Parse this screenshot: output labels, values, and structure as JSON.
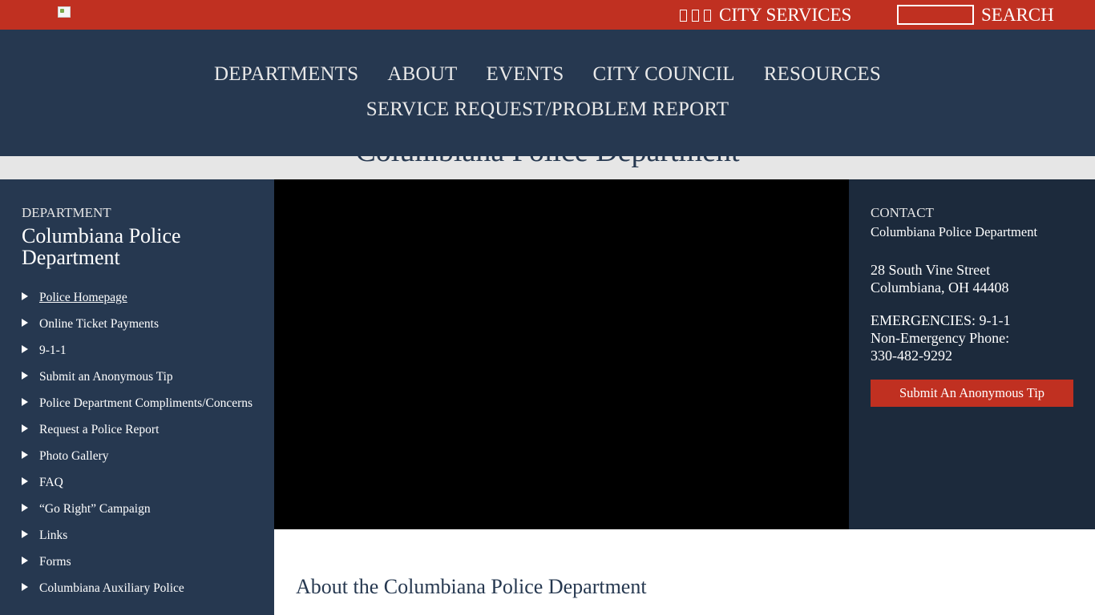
{
  "topbar": {
    "logo_icon": "broken-image-icon",
    "city_services_label": "CITY SERVICES",
    "search_value": "",
    "search_label": "SEARCH"
  },
  "nav": {
    "row1": [
      "DEPARTMENTS",
      "ABOUT",
      "EVENTS",
      "CITY COUNCIL",
      "RESOURCES"
    ],
    "row2": [
      "SERVICE REQUEST/PROBLEM REPORT"
    ]
  },
  "page_title": "Columbiana Police Department",
  "sidebar": {
    "eyebrow": "DEPARTMENT",
    "title": "Columbiana Police Department",
    "items": [
      {
        "label": "Police Homepage",
        "active": true
      },
      {
        "label": "Online Ticket Payments"
      },
      {
        "label": "9-1-1"
      },
      {
        "label": "Submit an Anonymous Tip"
      },
      {
        "label": "Police Department Compliments/Concerns"
      },
      {
        "label": "Request a Police Report"
      },
      {
        "label": "Photo Gallery"
      },
      {
        "label": "FAQ"
      },
      {
        "label": "“Go Right” Campaign"
      },
      {
        "label": "Links"
      },
      {
        "label": "Forms"
      },
      {
        "label": "Columbiana Auxiliary Police"
      }
    ]
  },
  "contact": {
    "eyebrow": "CONTACT",
    "name": "Columbiana Police Department",
    "address_line1": "28 South Vine Street",
    "address_line2": "Columbiana, OH 44408",
    "emergencies": "EMERGENCIES: 9-1-1",
    "non_emergency_label": "Non-Emergency Phone:",
    "phone": "330-482-9292",
    "tip_button": "Submit An Anonymous Tip"
  },
  "main": {
    "about_heading": "About the Columbiana Police Department"
  },
  "colors": {
    "red": "#c03021",
    "navy": "#263850",
    "dark_navy": "#1c2a3c",
    "grey_strip": "#e6e6e6"
  }
}
